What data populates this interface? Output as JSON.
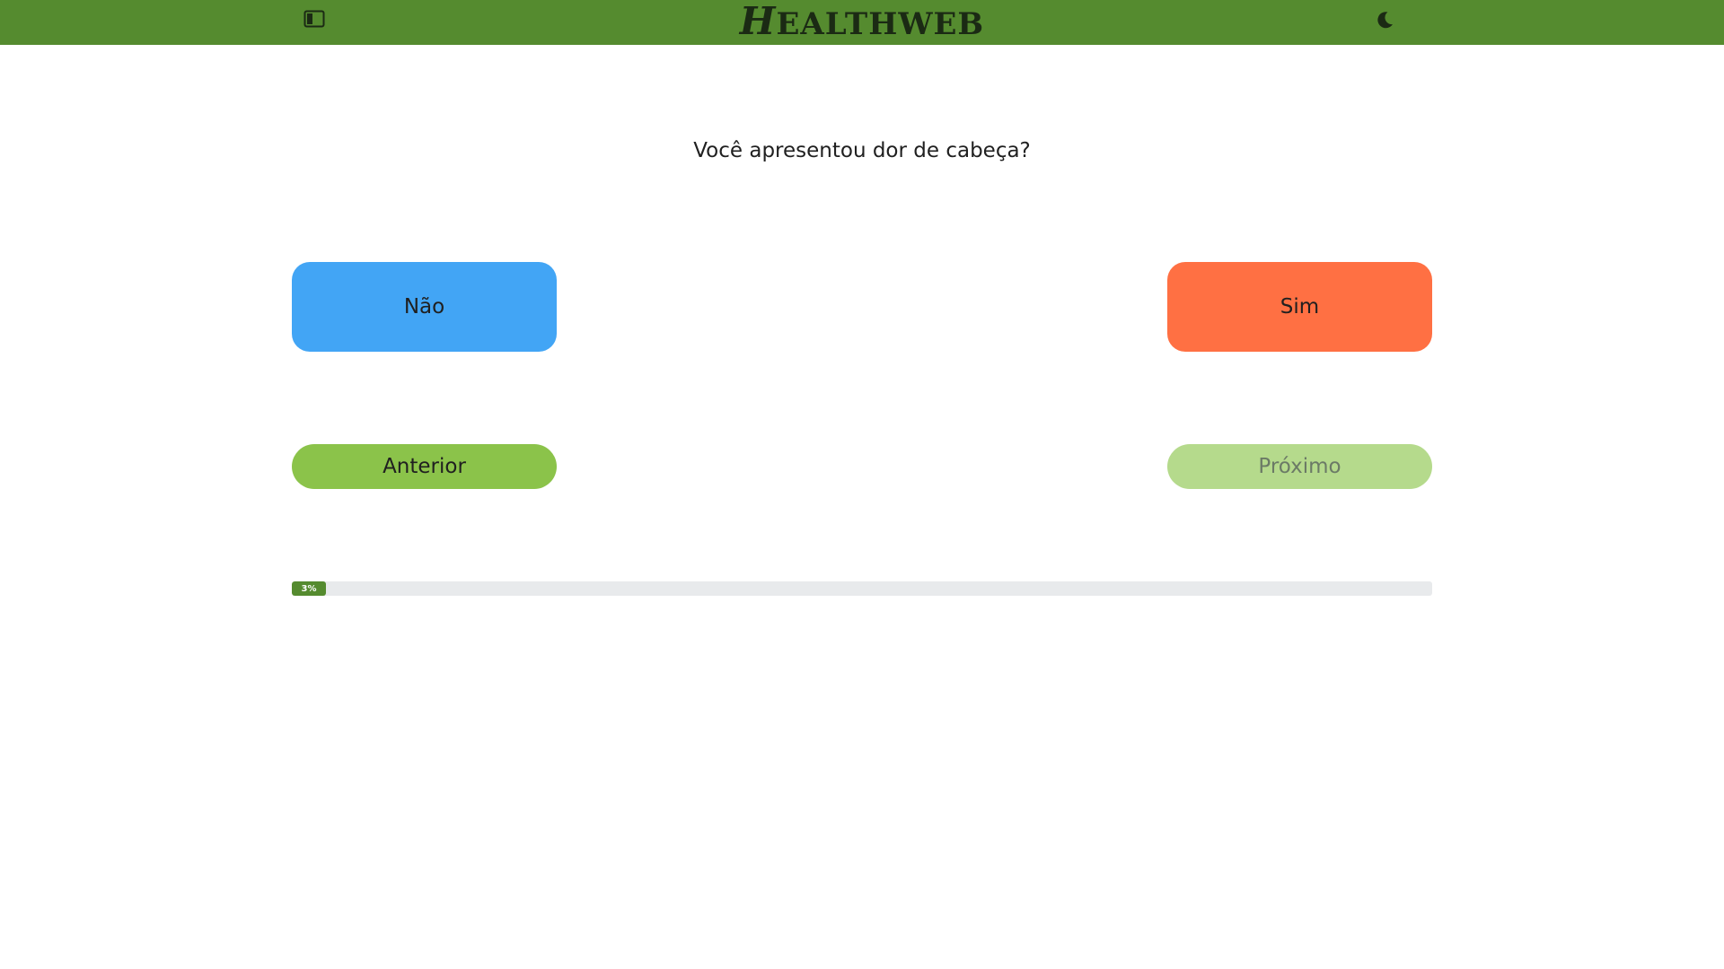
{
  "header": {
    "logo_first": "H",
    "logo_rest": "EALTHWEB",
    "sidebar_icon": "sidebar-toggle-icon",
    "theme_icon": "moon-icon",
    "bar_color": "#558b2f"
  },
  "quiz": {
    "question": "Você apresentou dor de cabeça?",
    "answer_no": "Não",
    "answer_yes": "Sim",
    "prev_label": "Anterior",
    "next_label": "Próximo",
    "colors": {
      "no": "#42a5f5",
      "yes": "#ff7043",
      "prev": "#8bc34a",
      "next_disabled": "#b5da8c"
    }
  },
  "progress": {
    "percent": 3,
    "label": "3%"
  }
}
